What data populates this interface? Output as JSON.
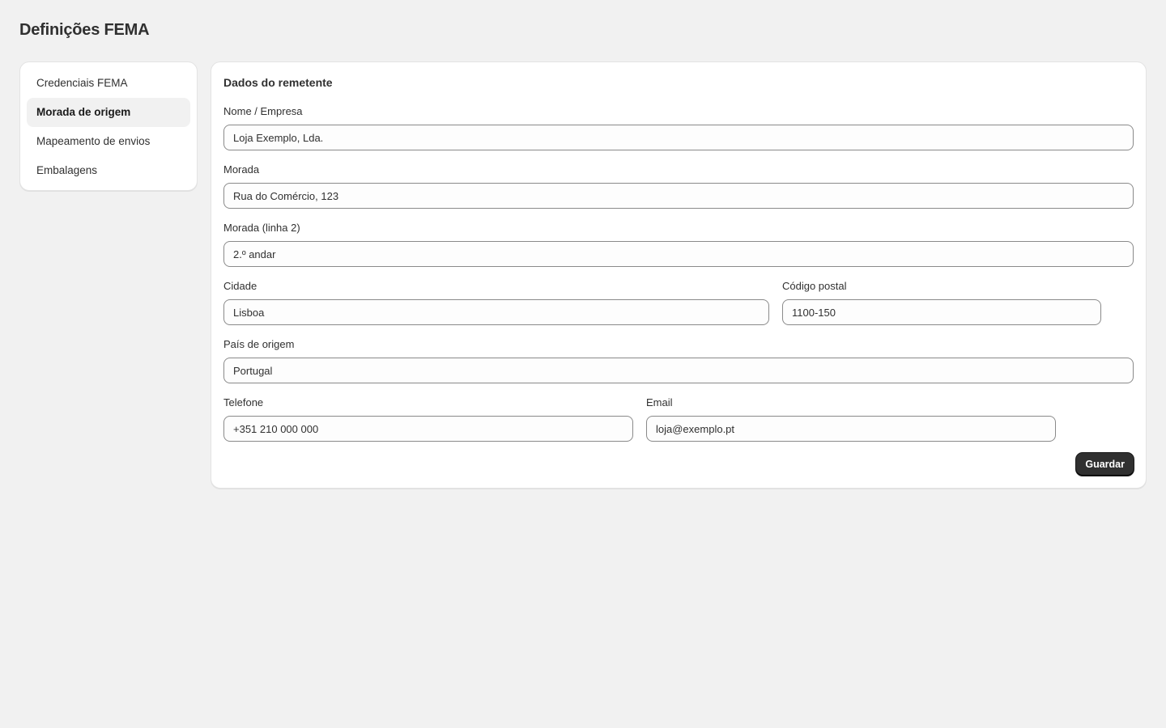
{
  "page": {
    "title": "Definições FEMA"
  },
  "sidebar": {
    "items": [
      {
        "label": "Credenciais FEMA",
        "active": false
      },
      {
        "label": "Morada de origem",
        "active": true
      },
      {
        "label": "Mapeamento de envios",
        "active": false
      },
      {
        "label": "Embalagens",
        "active": false
      }
    ]
  },
  "form": {
    "section_title": "Dados do remetente",
    "name": {
      "label": "Nome / Empresa",
      "value": "Loja Exemplo, Lda."
    },
    "address1": {
      "label": "Morada",
      "value": "Rua do Comércio, 123"
    },
    "address2": {
      "label": "Morada (linha 2)",
      "value": "2.º andar"
    },
    "city": {
      "label": "Cidade",
      "value": "Lisboa"
    },
    "postal_code": {
      "label": "Código postal",
      "value": "1100-150"
    },
    "country": {
      "label": "País de origem",
      "value": "Portugal"
    },
    "phone": {
      "label": "Telefone",
      "value": "+351 210 000 000"
    },
    "email": {
      "label": "Email",
      "value": "loja@exemplo.pt"
    },
    "save_label": "Guardar"
  },
  "colors": {
    "background": "#f1f1f1",
    "card": "#ffffff",
    "primary_button": "#303030",
    "active_nav": "#f1f1f1"
  }
}
